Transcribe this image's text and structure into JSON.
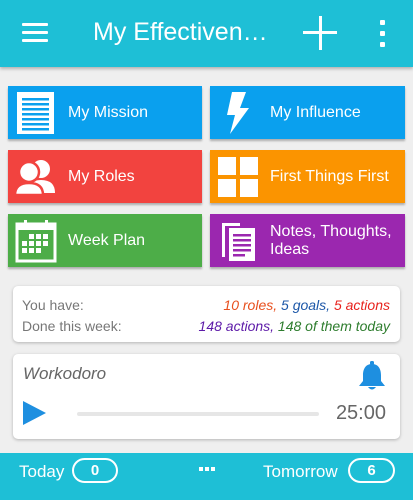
{
  "appbar": {
    "title": "My Effectivene…",
    "menu_icon": "hamburger-menu-icon",
    "add_icon": "plus-icon",
    "overflow_icon": "vertical-dots-icon"
  },
  "tiles": [
    {
      "label": "My Mission",
      "icon": "document-lines-icon",
      "color": "#0aa0ee"
    },
    {
      "label": "My Influence",
      "icon": "lightning-bolt-icon",
      "color": "#0aa0ee"
    },
    {
      "label": "My Roles",
      "icon": "people-icon",
      "color": "#f2433f"
    },
    {
      "label": "First Things First",
      "icon": "four-squares-icon",
      "color": "#fb9400"
    },
    {
      "label": "Week Plan",
      "icon": "calendar-icon",
      "color": "#4dad48"
    },
    {
      "label": "Notes, Thoughts, Ideas",
      "icon": "notes-pages-icon",
      "color": "#9b27af"
    }
  ],
  "stats": {
    "you_have_label": "You have:",
    "done_label": "Done this week:",
    "roles": "10 roles,",
    "goals": "5 goals,",
    "actions": "5 actions",
    "done_actions": "148 actions,",
    "done_of_them": "148 of them today",
    "colors": {
      "roles": "#e8501e",
      "goals": "#1c57a8",
      "actions": "#e8231e",
      "done_actions": "#5d1aa8",
      "done_of_them": "#2e7d2e"
    }
  },
  "workodoro": {
    "title": "Workodoro",
    "time": "25:00",
    "bell_icon": "bell-icon",
    "play_icon": "play-icon"
  },
  "bottom": {
    "today_label": "Today",
    "today_count": "0",
    "tomorrow_label": "Tomorrow",
    "tomorrow_count": "6",
    "more_icon": "horizontal-dots-icon"
  }
}
